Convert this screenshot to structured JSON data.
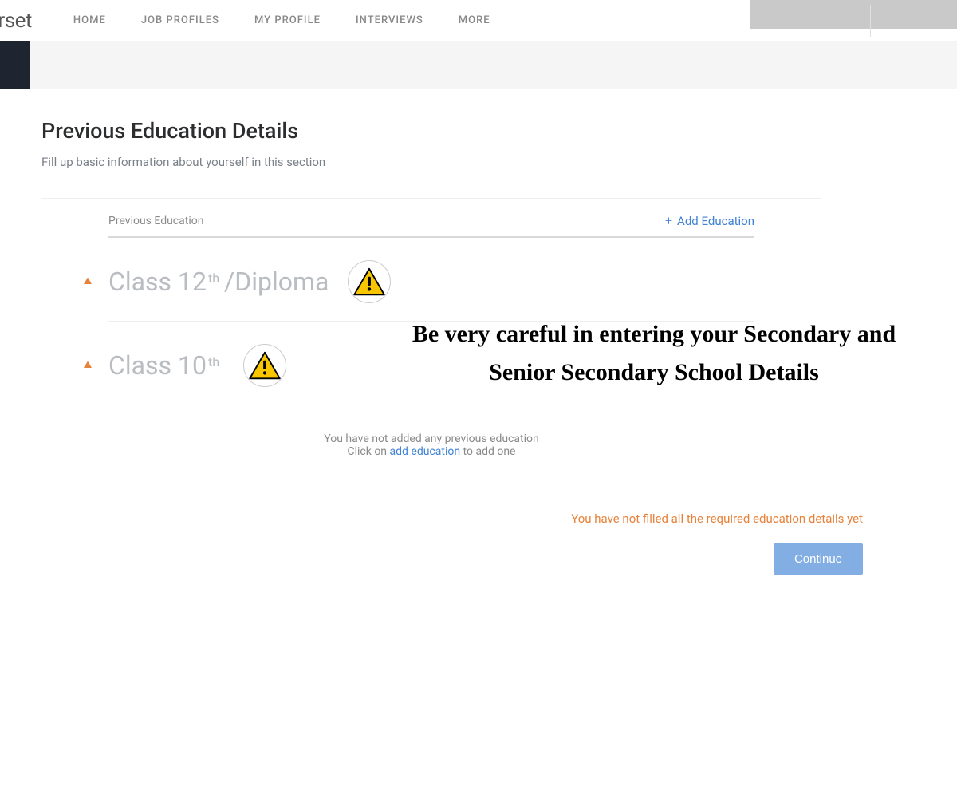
{
  "brand_fragment": "perset",
  "nav": {
    "home": "HOME",
    "job_profiles": "JOB PROFILES",
    "my_profile": "MY PROFILE",
    "interviews": "INTERVIEWS",
    "more": "MORE"
  },
  "page": {
    "title": "Previous Education Details",
    "subtitle": "Fill up basic information about yourself in this section"
  },
  "section": {
    "label": "Previous Education",
    "add_label": "Add Education",
    "plus_glyph": "+"
  },
  "edu_rows": {
    "row1_pre": "Class 12",
    "row1_sup": "th",
    "row1_post": " /Diploma",
    "row2_pre": "Class 10",
    "row2_sup": "th",
    "row2_post": ""
  },
  "callout_text": "Be very careful in entering your Secondary and Senior Secondary School Details",
  "empty_state": {
    "line1": "You have not added any previous education",
    "line2_pre": "Click on ",
    "line2_link": "add education",
    "line2_post": " to add one"
  },
  "footer": {
    "warning": "You have not filled all the required education details yet",
    "continue": "Continue"
  },
  "icons": {
    "warn_small_name": "warning-triangle-icon",
    "warn_big_name": "warning-triangle-icon"
  },
  "colors": {
    "accent_blue": "#3f82d6",
    "warn_orange": "#e8823a",
    "continue_bg": "#82aee3",
    "gray_text": "#8a8a8a",
    "faded_title": "#b9bcc0"
  }
}
